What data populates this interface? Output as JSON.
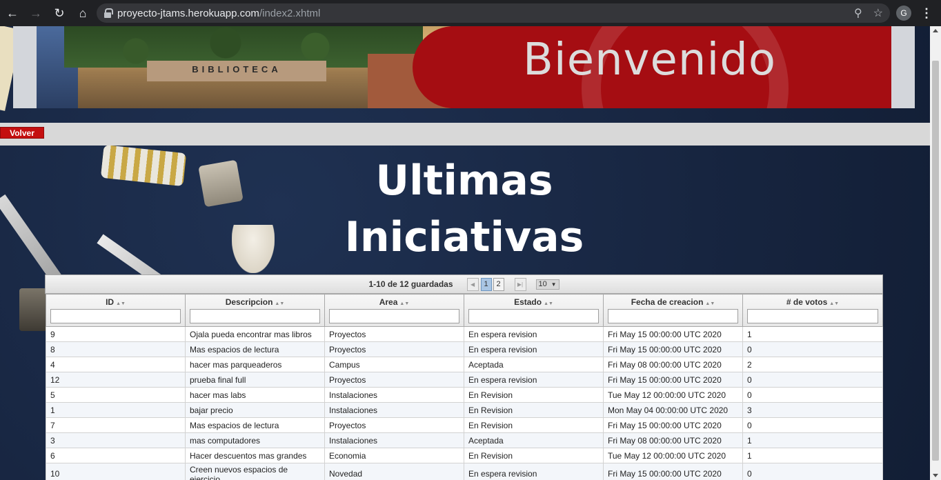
{
  "browser": {
    "url_host": "proyecto-jtams.herokuapp.com",
    "url_path": "/index2.xhtml",
    "profile_initial": "G"
  },
  "banner": {
    "library_sign": "BIBLIOTECA",
    "welcome": "Bienvenido"
  },
  "nav": {
    "volver_label": "Volver"
  },
  "page": {
    "title_line1": "Ultimas",
    "title_line2": "Iniciativas"
  },
  "paginator": {
    "report": "1-10 de 12 guardadas",
    "pages": [
      "1",
      "2"
    ],
    "current_page": "1",
    "rows_per_page": "10"
  },
  "table": {
    "columns": [
      "ID",
      "Descripcion",
      "Area",
      "Estado",
      "Fecha de creacion",
      "# de votos"
    ],
    "rows": [
      [
        "9",
        "Ojala pueda encontrar mas libros",
        "Proyectos",
        "En espera revision",
        "Fri May 15 00:00:00 UTC 2020",
        "1"
      ],
      [
        "8",
        "Mas espacios de lectura",
        "Proyectos",
        "En espera revision",
        "Fri May 15 00:00:00 UTC 2020",
        "0"
      ],
      [
        "4",
        "hacer mas parqueaderos",
        "Campus",
        "Aceptada",
        "Fri May 08 00:00:00 UTC 2020",
        "2"
      ],
      [
        "12",
        "prueba final full",
        "Proyectos",
        "En espera revision",
        "Fri May 15 00:00:00 UTC 2020",
        "0"
      ],
      [
        "5",
        "hacer mas labs",
        "Instalaciones",
        "En Revision",
        "Tue May 12 00:00:00 UTC 2020",
        "0"
      ],
      [
        "1",
        "bajar precio",
        "Instalaciones",
        "En Revision",
        "Mon May 04 00:00:00 UTC 2020",
        "3"
      ],
      [
        "7",
        "Mas espacios de lectura",
        "Proyectos",
        "En Revision",
        "Fri May 15 00:00:00 UTC 2020",
        "0"
      ],
      [
        "3",
        "mas computadores",
        "Instalaciones",
        "Aceptada",
        "Fri May 08 00:00:00 UTC 2020",
        "1"
      ],
      [
        "6",
        "Hacer descuentos mas grandes",
        "Economia",
        "En Revision",
        "Tue May 12 00:00:00 UTC 2020",
        "1"
      ],
      [
        "10",
        "Creen nuevos espacios de ejercicio",
        "Novedad",
        "En espera revision",
        "Fri May 15 00:00:00 UTC 2020",
        "0"
      ]
    ]
  }
}
